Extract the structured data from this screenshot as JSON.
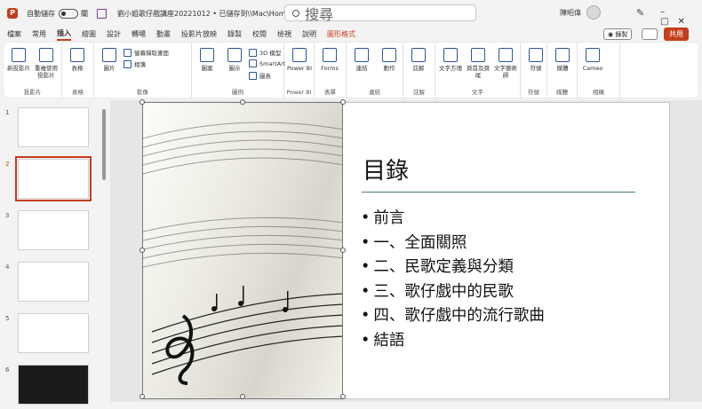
{
  "titlebar": {
    "app_logo": "P",
    "autosave_label": "自動儲存",
    "autosave_state": "關",
    "document_title": "劉小姐歌仔戲講座20221012 • 已儲存到\\\\Mac\\Home",
    "search_placeholder": "搜尋",
    "user_name": "陳昭偉"
  },
  "ribbon_tabs": [
    "檔案",
    "常用",
    "插入",
    "繪圖",
    "設計",
    "轉場",
    "動畫",
    "投影片放映",
    "錄製",
    "校閱",
    "檢視",
    "說明",
    "圖形格式"
  ],
  "active_tab": "插入",
  "record_label": "錄製",
  "share_label": "共用",
  "ribbon": {
    "groups": [
      {
        "label": "投影片",
        "buttons": [
          "新投影片",
          "重複使用投影片"
        ]
      },
      {
        "label": "表格",
        "buttons": [
          "表格"
        ]
      },
      {
        "label": "影像",
        "buttons": [
          "圖片"
        ],
        "small": [
          "螢幕擷取畫面",
          "相簿"
        ]
      },
      {
        "label": "圖例",
        "buttons": [
          "圖案",
          "圖示"
        ],
        "small": [
          "3D 模型",
          "SmartArt",
          "圖表"
        ]
      },
      {
        "label": "Power BI",
        "buttons": [
          "Power BI"
        ]
      },
      {
        "label": "表單",
        "buttons": [
          "Forms"
        ]
      },
      {
        "label": "連結",
        "buttons": [
          "連結",
          "動作"
        ]
      },
      {
        "label": "註解",
        "buttons": [
          "註解"
        ]
      },
      {
        "label": "文字",
        "buttons": [
          "文字方塊",
          "頁首及頁尾",
          "文字藝術師"
        ]
      },
      {
        "label": "符號",
        "buttons": [
          "符號"
        ]
      },
      {
        "label": "媒體",
        "buttons": [
          "媒體"
        ]
      },
      {
        "label": "相機",
        "buttons": [
          "Cameo"
        ]
      }
    ]
  },
  "thumbnails": [
    {
      "num": "1",
      "selected": false
    },
    {
      "num": "2",
      "selected": true
    },
    {
      "num": "3",
      "selected": false
    },
    {
      "num": "4",
      "selected": false
    },
    {
      "num": "5",
      "selected": false
    },
    {
      "num": "6",
      "selected": false
    }
  ],
  "slide": {
    "title": "目錄",
    "bullets": [
      "前言",
      "一、全面關照",
      "二、民歌定義與分類",
      "三、歌仔戲中的民歌",
      "四、歌仔戲中的流行歌曲",
      "結語"
    ]
  },
  "colors": {
    "accent": "#c43e1c",
    "rule": "#4a7c74"
  }
}
